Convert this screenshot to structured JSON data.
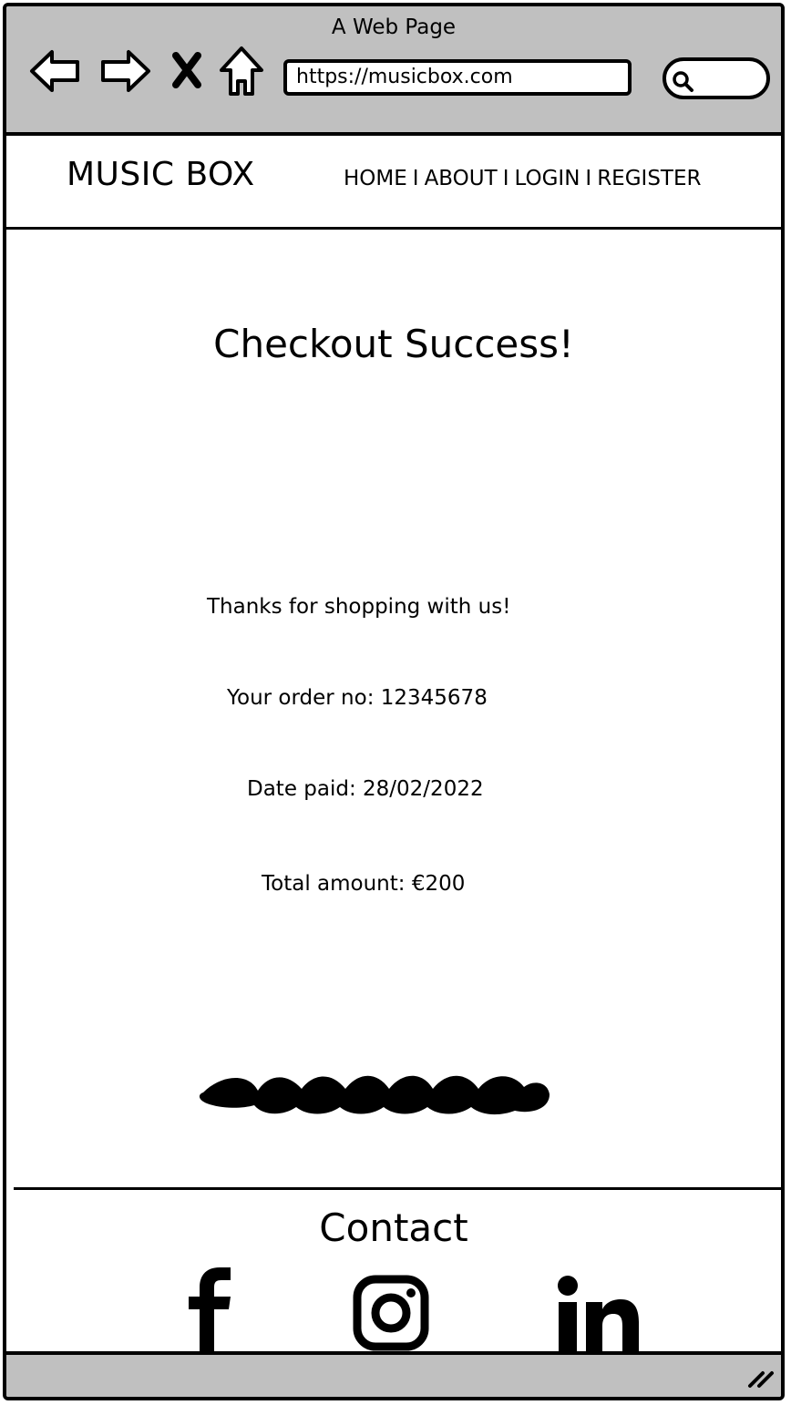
{
  "browser": {
    "window_title": "A Web Page",
    "url": "https://musicbox.com",
    "icons": [
      "back-arrow-icon",
      "forward-arrow-icon",
      "close-icon",
      "home-icon",
      "search-icon",
      "resize-handle-icon"
    ]
  },
  "site": {
    "brand": "MUSIC BOX",
    "nav": {
      "home": "HOME",
      "about": "ABOUT",
      "login": "LOGIN",
      "register": "REGISTER",
      "separator": "I"
    }
  },
  "main": {
    "heading": "Checkout Success!",
    "thanks": "Thanks for shopping with us!",
    "order_no": "Your order no: 12345678",
    "date_paid": "Date paid: 28/02/2022",
    "total": "Total amount: €200"
  },
  "footer": {
    "contact_title": "Contact",
    "social_icons": [
      "facebook-icon",
      "instagram-icon",
      "linkedin-icon"
    ]
  },
  "colors": {
    "chrome": "#c0c0c0",
    "ink": "#000000",
    "page": "#ffffff"
  }
}
